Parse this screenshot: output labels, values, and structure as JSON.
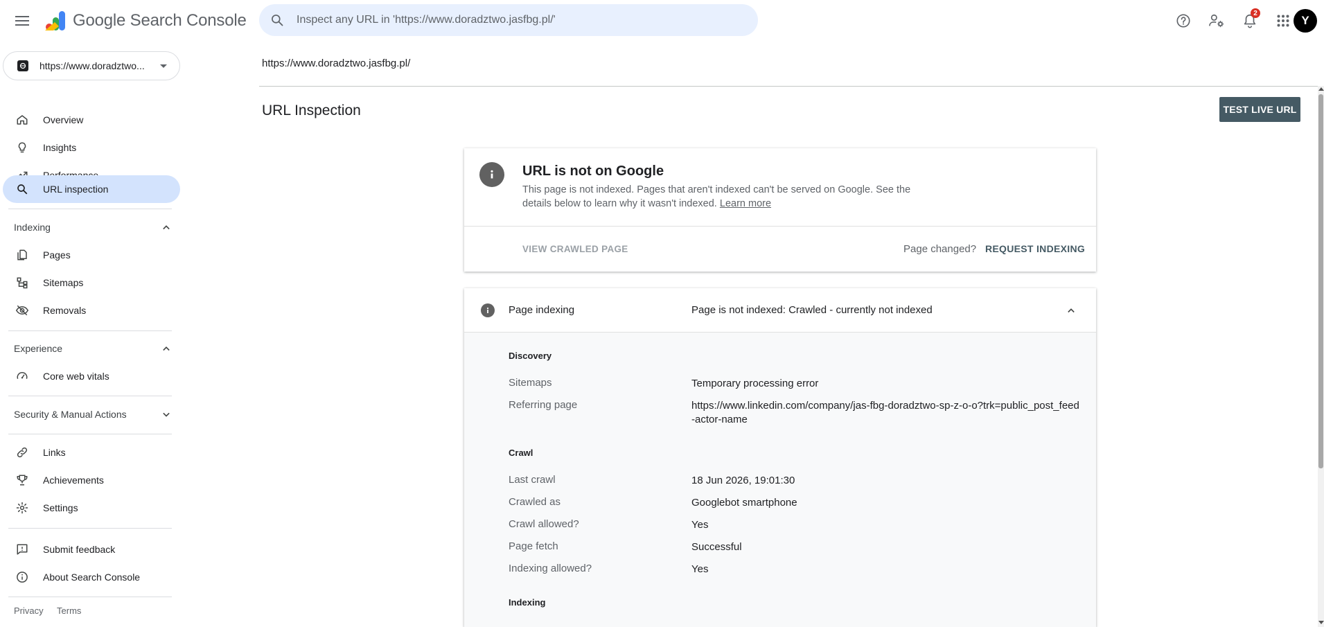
{
  "header": {
    "app_name": "Google Search Console",
    "search_placeholder": "Inspect any URL in 'https://www.doradztwo.jasfbg.pl/'",
    "notifications_count": "2",
    "avatar_letter": "Y"
  },
  "sidebar": {
    "property_label": "https://www.doradztwo...",
    "items_top": [
      {
        "label": "Overview",
        "icon": "home-icon"
      },
      {
        "label": "Insights",
        "icon": "lightbulb-icon"
      },
      {
        "label": "Performance",
        "icon": "trending-icon"
      },
      {
        "label": "URL inspection",
        "icon": "search-icon",
        "active": true
      }
    ],
    "sections": {
      "indexing": "Indexing",
      "experience": "Experience",
      "security": "Security & Manual Actions"
    },
    "indexing_items": [
      "Pages",
      "Sitemaps",
      "Removals"
    ],
    "experience_items": [
      "Core web vitals"
    ],
    "misc_items": [
      "Links",
      "Achievements",
      "Settings"
    ],
    "bottom_items": [
      "Submit feedback",
      "About Search Console"
    ],
    "footer": {
      "privacy": "Privacy",
      "terms": "Terms"
    }
  },
  "main": {
    "breadcrumb": "https://www.doradztwo.jasfbg.pl/",
    "title": "URL Inspection",
    "test_live_url": "TEST LIVE URL",
    "status_card": {
      "title": "URL is not on Google",
      "description": "This page is not indexed. Pages that aren't indexed can't be served on Google. See the details below to learn why it wasn't indexed.",
      "learn_more": "Learn more",
      "view_crawled": "VIEW CRAWLED PAGE",
      "page_changed": "Page changed?",
      "request_indexing": "REQUEST INDEXING"
    },
    "indexing_card": {
      "label": "Page indexing",
      "value": "Page is not indexed: Crawled - currently not indexed",
      "discovery_title": "Discovery",
      "sitemaps_label": "Sitemaps",
      "sitemaps_value": "Temporary processing error",
      "referring_label": "Referring page",
      "referring_value": "https://www.linkedin.com/company/jas-fbg-doradztwo-sp-z-o-o?trk=public_post_feed-actor-name",
      "crawl_title": "Crawl",
      "last_crawl_label": "Last crawl",
      "last_crawl_value": "18 Jun 2026, 19:01:30",
      "crawled_as_label": "Crawled as",
      "crawled_as_value": "Googlebot smartphone",
      "crawl_allowed_label": "Crawl allowed?",
      "crawl_allowed_value": "Yes",
      "page_fetch_label": "Page fetch",
      "page_fetch_value": "Successful",
      "indexing_allowed_label": "Indexing allowed?",
      "indexing_allowed_value": "Yes",
      "indexing_title": "Indexing"
    }
  },
  "colors": {
    "active_nav": "#d3e3fd",
    "search_bg": "#e8f0fe",
    "primary_button": "#455a64",
    "badge": "#d93025"
  }
}
